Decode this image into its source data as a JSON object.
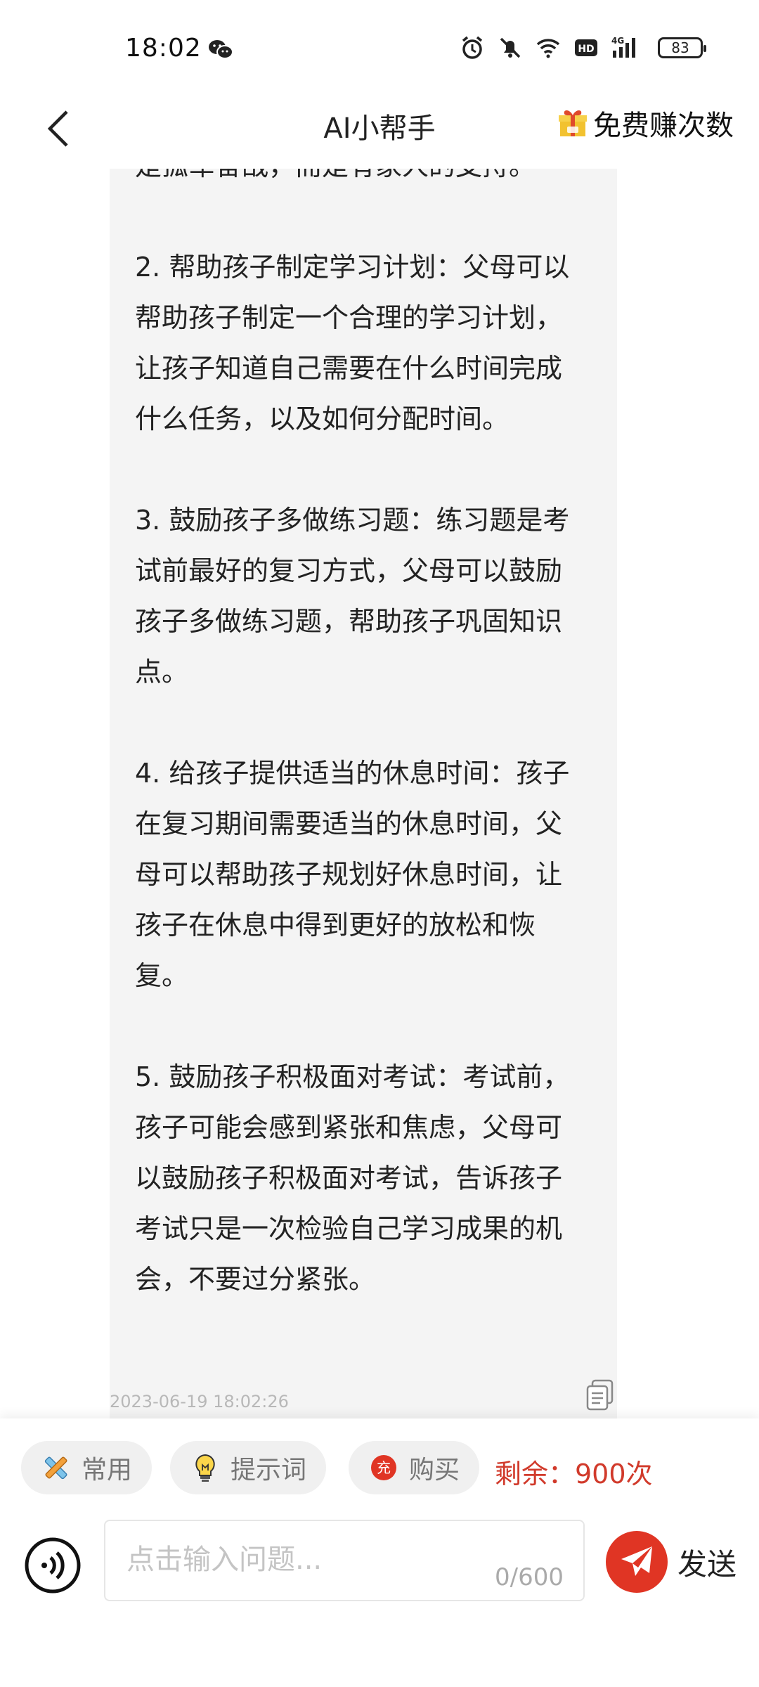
{
  "status_bar": {
    "time": "18:02",
    "battery": "83",
    "icons": [
      "wechat-icon",
      "alarm-icon",
      "mute-icon",
      "wifi-icon",
      "hd-icon",
      "signal-4g-icon",
      "battery-icon"
    ]
  },
  "nav": {
    "title": "AI小帮手",
    "earn_label": "免费赚次数"
  },
  "message": {
    "text": "是孤军奋战，而是有家人的支持。\n\n2. 帮助孩子制定学习计划：父母可以帮助孩子制定一个合理的学习计划，让孩子知道自己需要在什么时间完成什么任务，以及如何分配时间。\n\n3. 鼓励孩子多做练习题：练习题是考试前最好的复习方式，父母可以鼓励孩子多做练习题，帮助孩子巩固知识点。\n\n4. 给孩子提供适当的休息时间：孩子在复习期间需要适当的休息时间，父母可以帮助孩子规划好休息时间，让孩子在休息中得到更好的放松和恢复。\n\n5. 鼓励孩子积极面对考试：考试前，孩子可能会感到紧张和焦虑，父母可以鼓励孩子积极面对考试，告诉孩子考试只是一次检验自己学习成果的机会，不要过分紧张。",
    "timestamp": "2023-06-19 18:02:26"
  },
  "bottom": {
    "chips": [
      {
        "label": "常用",
        "icon": "pencil-ruler-icon"
      },
      {
        "label": "提示词",
        "icon": "lightbulb-icon"
      },
      {
        "label": "购买",
        "icon": "recharge-icon",
        "icon_text": "充"
      }
    ],
    "remaining": "剩余：900次",
    "input": {
      "placeholder": "点击输入问题...",
      "value": "",
      "counter": "0/600"
    },
    "send_label": "发送"
  },
  "colors": {
    "accent": "#e03524",
    "remaining_text": "#d13a2b",
    "bubble_bg": "#f4f4f4"
  }
}
